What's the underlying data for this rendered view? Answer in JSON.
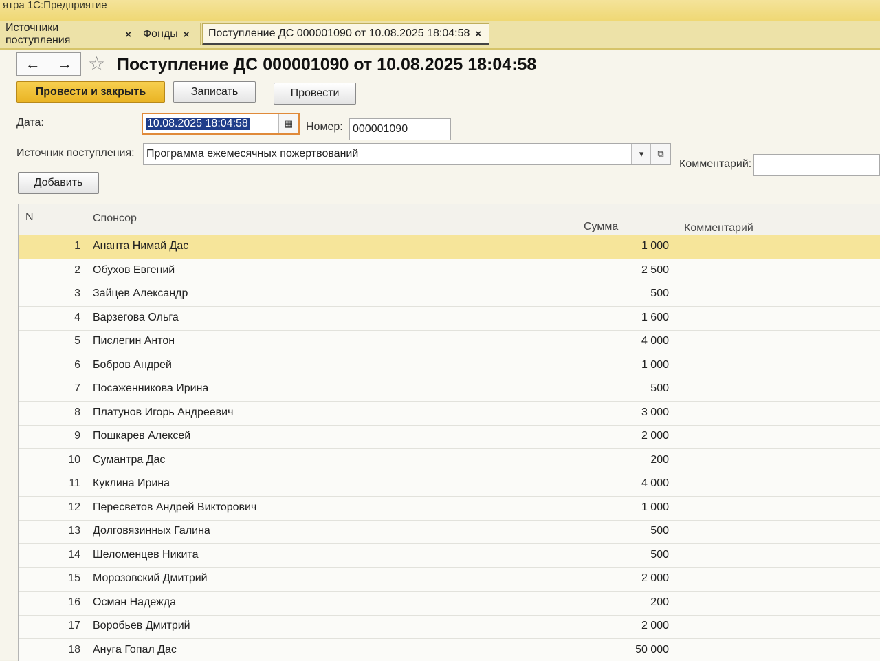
{
  "app": {
    "title": "ятра 1С:Предприятие"
  },
  "tabs": [
    {
      "label": "Источники поступления",
      "close": "×"
    },
    {
      "label": "Фонды",
      "close": "×"
    },
    {
      "label": "Поступление ДС 000001090 от 10.08.2025 18:04:58",
      "close": "×"
    }
  ],
  "nav": {
    "back": "←",
    "forward": "→",
    "favorite": "☆"
  },
  "document": {
    "title": "Поступление ДС 000001090 от 10.08.2025 18:04:58"
  },
  "toolbar": {
    "post_close_label": "Провести и закрыть",
    "save_label": "Записать",
    "post_label": "Провести",
    "add_label": "Добавить"
  },
  "form": {
    "date_label": "Дата:",
    "date_value": "10.08.2025 18:04:58",
    "number_label": "Номер:",
    "number_value": "000001090",
    "source_label": "Источник поступления:",
    "source_value": "Программа ежемесячных пожертвований",
    "comment_label": "Комментарий:",
    "comment_value": ""
  },
  "table": {
    "columns": {
      "n": "N",
      "sponsor": "Спонсор",
      "sum": "Сумма",
      "comment": "Комментарий"
    },
    "rows": [
      {
        "n": "1",
        "sponsor": "Ананта Нимай Дас",
        "sum": "1 000"
      },
      {
        "n": "2",
        "sponsor": "Обухов Евгений",
        "sum": "2 500"
      },
      {
        "n": "3",
        "sponsor": "Зайцев Александр",
        "sum": "500"
      },
      {
        "n": "4",
        "sponsor": "Варзегова Ольга",
        "sum": "1 600"
      },
      {
        "n": "5",
        "sponsor": "Пислегин Антон",
        "sum": "4 000"
      },
      {
        "n": "6",
        "sponsor": "Бобров Андрей",
        "sum": "1 000"
      },
      {
        "n": "7",
        "sponsor": "Посаженникова Ирина",
        "sum": "500"
      },
      {
        "n": "8",
        "sponsor": "Платунов Игорь Андреевич",
        "sum": "3 000"
      },
      {
        "n": "9",
        "sponsor": "Пошкарев Алексей",
        "sum": "2 000"
      },
      {
        "n": "10",
        "sponsor": "Сумантра Дас",
        "sum": "200"
      },
      {
        "n": "11",
        "sponsor": "Куклина Ирина",
        "sum": "4 000"
      },
      {
        "n": "12",
        "sponsor": "Пересветов Андрей Викторович",
        "sum": "1 000"
      },
      {
        "n": "13",
        "sponsor": "Долговязинных Галина",
        "sum": "500"
      },
      {
        "n": "14",
        "sponsor": "Шеломенцев Никита",
        "sum": "500"
      },
      {
        "n": "15",
        "sponsor": "Морозовский Дмитрий",
        "sum": "2 000"
      },
      {
        "n": "16",
        "sponsor": "Осман Надежда",
        "sum": "200"
      },
      {
        "n": "17",
        "sponsor": "Воробьев Дмитрий",
        "sum": "2 000"
      },
      {
        "n": "18",
        "sponsor": "Ануга Гопал Дас",
        "sum": "50 000"
      }
    ]
  }
}
